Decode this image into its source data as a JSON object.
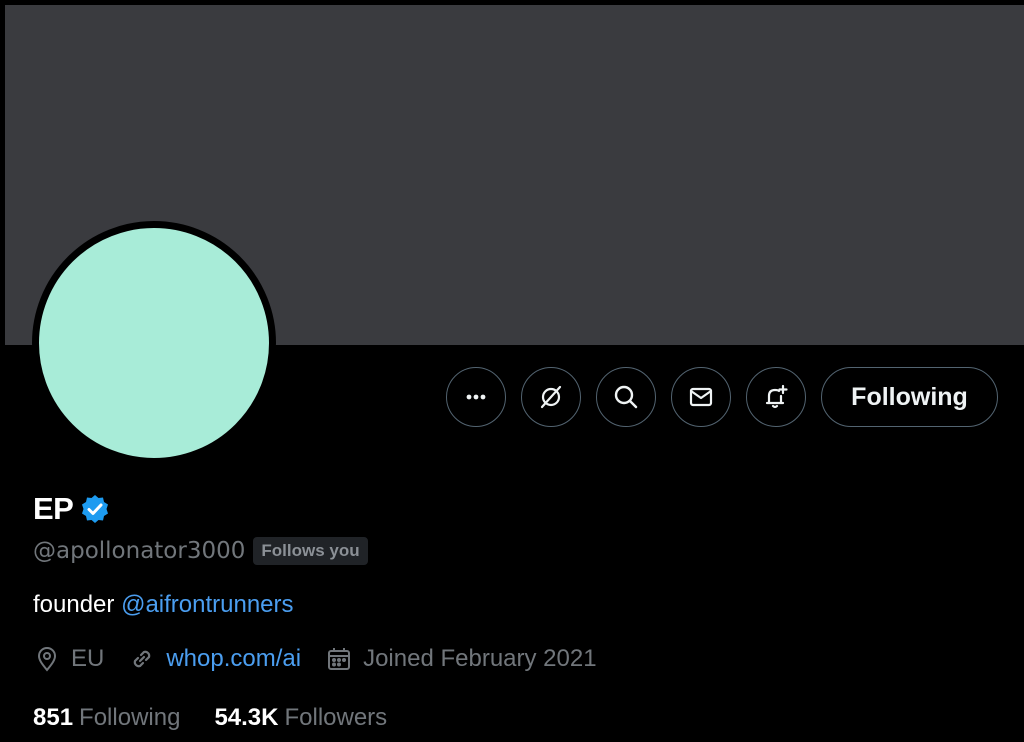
{
  "profile": {
    "display_name": "EP",
    "handle": "@apollonator3000",
    "follows_you": "Follows you",
    "bio_prefix": "founder",
    "bio_mention": "@aifrontrunners",
    "location": "EU",
    "website": "whop.com/ai",
    "joined": "Joined February 2021",
    "following_count": "851",
    "following_label": "Following",
    "followers_count": "54.3K",
    "followers_label": "Followers"
  },
  "actions": {
    "more_icon": "more-icon",
    "grok_icon": "grok-icon",
    "search_icon": "search-icon",
    "message_icon": "mail-icon",
    "notify_icon": "bell-plus-icon",
    "follow_label": "Following"
  },
  "colors": {
    "banner": "#3a3b3f",
    "avatar": "#a8ecd8",
    "accent": "#4b9ef0",
    "background": "#000000"
  }
}
